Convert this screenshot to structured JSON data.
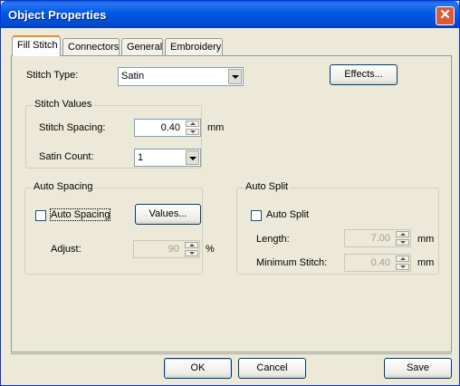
{
  "window": {
    "title": "Object Properties",
    "close_icon": "close-icon"
  },
  "tabs": [
    {
      "label": "Fill Stitch",
      "active": true
    },
    {
      "label": "Connectors",
      "active": false
    },
    {
      "label": "General",
      "active": false
    },
    {
      "label": "Embroidery",
      "active": false
    }
  ],
  "stitch_type": {
    "label": "Stitch Type:",
    "value": "Satin"
  },
  "effects_button": "Effects...",
  "stitch_values": {
    "legend": "Stitch Values",
    "spacing_label": "Stitch Spacing:",
    "spacing_value": "0.40",
    "spacing_unit": "mm",
    "satin_count_label": "Satin Count:",
    "satin_count_value": "1"
  },
  "auto_spacing": {
    "legend": "Auto Spacing",
    "checkbox_label": "Auto Spacing",
    "checked": false,
    "values_button": "Values...",
    "adjust_label": "Adjust:",
    "adjust_value": "90",
    "adjust_unit": "%"
  },
  "auto_split": {
    "legend": "Auto Split",
    "checkbox_label": "Auto Split",
    "checked": false,
    "length_label": "Length:",
    "length_value": "7.00",
    "length_unit": "mm",
    "min_stitch_label": "Minimum Stitch:",
    "min_stitch_value": "0.40",
    "min_stitch_unit": "mm"
  },
  "footer": {
    "ok": "OK",
    "cancel": "Cancel",
    "save": "Save"
  }
}
